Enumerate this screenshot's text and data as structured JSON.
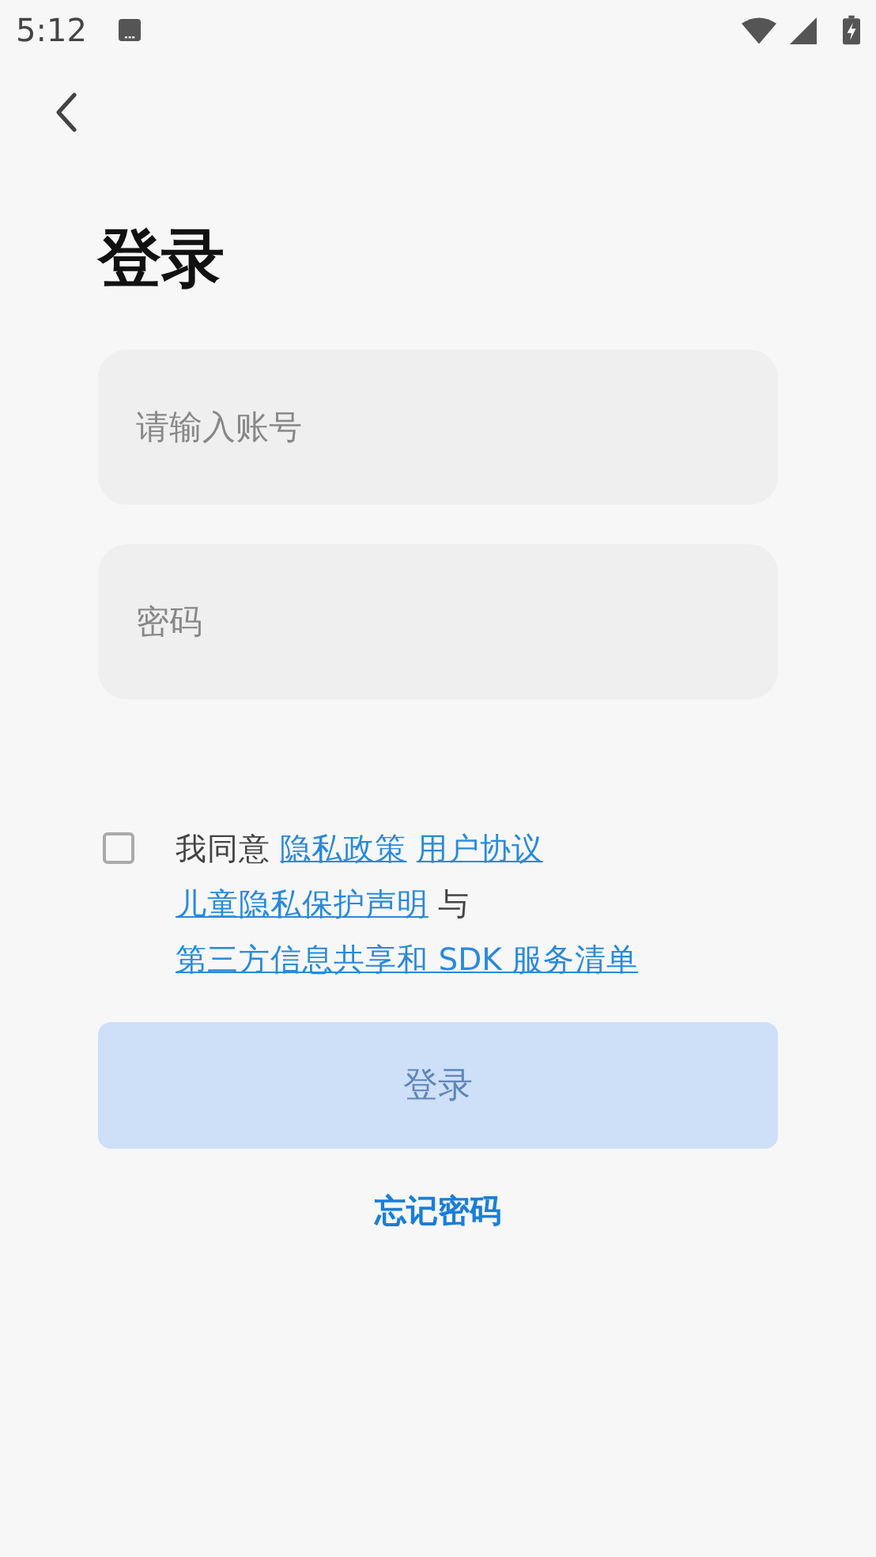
{
  "status_bar": {
    "time": "5:12"
  },
  "title": "登录",
  "fields": [
    {
      "placeholder": "请输入账号"
    },
    {
      "placeholder": "密码"
    }
  ],
  "agreement": {
    "checked": false,
    "parts": [
      {
        "kind": "text",
        "text": "我同意"
      },
      {
        "kind": "link",
        "text": "隐私政策"
      },
      {
        "kind": "link",
        "text": "用户协议"
      },
      {
        "kind": "link",
        "text": "儿童隐私保护声明"
      },
      {
        "kind": "text",
        "text": "与"
      },
      {
        "kind": "link",
        "text": "第三方信息共享和 SDK 服务清单"
      }
    ]
  },
  "login_button": {
    "label": "登录",
    "disabled": true
  },
  "forgot_link": "忘记密码"
}
